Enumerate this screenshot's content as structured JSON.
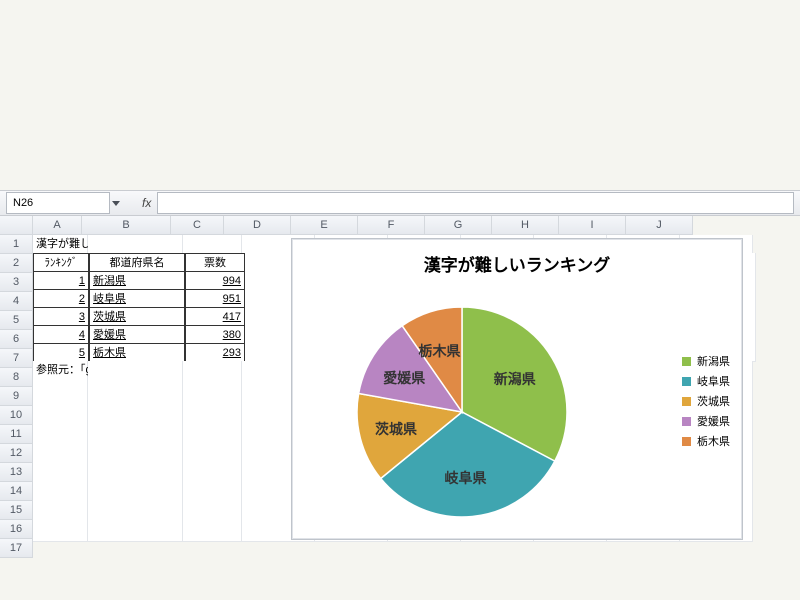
{
  "formula_bar": {
    "active_cell": "N26",
    "fx_label": "fx",
    "formula_value": ""
  },
  "columns": [
    "A",
    "B",
    "C",
    "D",
    "E",
    "F",
    "G",
    "H",
    "I",
    "J"
  ],
  "rows_visible": 17,
  "table": {
    "title": "漢字が難しいランキング",
    "headers": {
      "rank": "ﾗﾝｷﾝｸﾞ",
      "name": "都道府県名",
      "votes": "票数"
    },
    "rows": [
      {
        "rank": "1",
        "name": "新潟県",
        "votes": "994"
      },
      {
        "rank": "2",
        "name": "岐阜県",
        "votes": "951"
      },
      {
        "rank": "3",
        "name": "茨城県",
        "votes": "417"
      },
      {
        "rank": "4",
        "name": "愛媛県",
        "votes": "380"
      },
      {
        "rank": "5",
        "name": "栃木県",
        "votes": "293"
      }
    ],
    "source": "参照元：「gooランキング」"
  },
  "chart_data": {
    "type": "pie",
    "title": "漢字が難しいランキング",
    "categories": [
      "新潟県",
      "岐阜県",
      "茨城県",
      "愛媛県",
      "栃木県"
    ],
    "values": [
      994,
      951,
      417,
      380,
      293
    ],
    "colors": [
      "#8fbf4b",
      "#3fa5b0",
      "#e0a63c",
      "#b885c2",
      "#e08a45"
    ],
    "legend_position": "right"
  }
}
